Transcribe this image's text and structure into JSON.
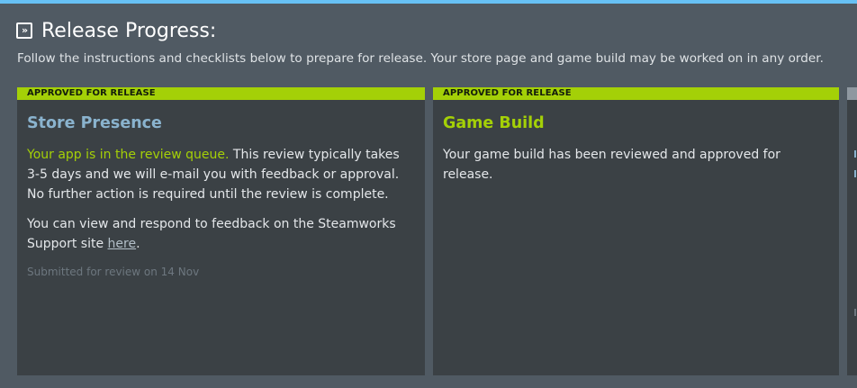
{
  "header": {
    "icon": "fast-forward-icon",
    "title": "Release Progress:"
  },
  "description": "Follow the instructions and checklists below to prepare for release. Your store page and game build may be worked on in any order.",
  "cards": [
    {
      "badge": "APPROVED FOR RELEASE",
      "title": "Store Presence",
      "status_highlight": "Your app is in the review queue.",
      "status_text": " This review typically takes 3-5 days and we will e-mail you with feedback or approval. No further action is required until the review is complete.",
      "feedback_text": "You can view and respond to feedback on the Steamworks Support site ",
      "feedback_link": "here",
      "feedback_end": ".",
      "meta": "Submitted for review on 14 Nov"
    },
    {
      "badge": "APPROVED FOR RELEASE",
      "title": "Game Build",
      "status_text": "Your game build has been reviewed and approved for release."
    }
  ],
  "colors": {
    "background": "#505a63",
    "card": "#3b4145",
    "approved_badge": "#a4d007",
    "link_blue": "#8ab3ce",
    "top_accent": "#67c1f5"
  }
}
